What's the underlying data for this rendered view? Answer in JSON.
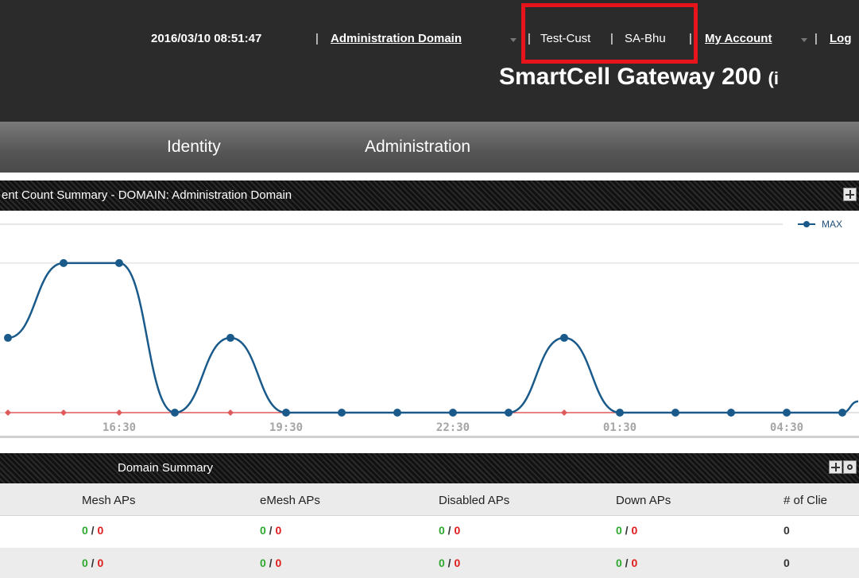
{
  "header": {
    "datetime": "2016/03/10 08:51:47",
    "sep": "|",
    "admin_domain": "Administration Domain",
    "tenant": "Test-Cust",
    "user": "SA-Bhu",
    "my_account": "My Account",
    "logout_partial": "Log",
    "product_title": "SmartCell Gateway 200",
    "product_suffix": "(i",
    "highlight_color": "#e8141b"
  },
  "nav": {
    "items": [
      {
        "label": "Identity"
      },
      {
        "label": "Administration"
      }
    ]
  },
  "chart_panel": {
    "title": "ent Count Summary - DOMAIN: Administration Domain",
    "expand_icon": "plus-square-icon"
  },
  "chart_data": {
    "type": "line",
    "x_tick_labels": [
      "16:30",
      "19:30",
      "22:30",
      "01:30",
      "04:30"
    ],
    "series": [
      {
        "name": "MAX",
        "color": "#1a5a8a",
        "values": [
          1,
          2,
          2,
          0,
          1,
          0,
          0,
          0,
          0,
          0,
          1,
          0,
          0,
          0,
          0,
          0
        ],
        "partial_end": 0.15
      },
      {
        "name": "",
        "color": "#e05a5a",
        "values": [
          0,
          0,
          0,
          0,
          0,
          0,
          0,
          0,
          0,
          0,
          0,
          0,
          0,
          0,
          0,
          0
        ]
      }
    ],
    "x_step_minutes": 60,
    "ylim": [
      0,
      2.7
    ],
    "gridlines_at": [
      2
    ],
    "legend_position": "top-right"
  },
  "summary_panel": {
    "title": "Domain Summary",
    "icons": [
      "plus-square-icon",
      "gear-icon"
    ]
  },
  "table": {
    "columns": [
      "Mesh APs",
      "eMesh APs",
      "Disabled APs",
      "Down APs",
      "# of Clie"
    ],
    "rows": [
      {
        "mesh": {
          "a": "0",
          "sep": " / ",
          "b": "0"
        },
        "emesh": {
          "a": "0",
          "sep": " / ",
          "b": "0"
        },
        "disabled": {
          "a": "0",
          "sep": " / ",
          "b": "0"
        },
        "down": {
          "a": "0",
          "sep": " / ",
          "b": "0"
        },
        "clients": "0"
      },
      {
        "mesh": {
          "a": "0",
          "sep": " / ",
          "b": "0"
        },
        "emesh": {
          "a": "0",
          "sep": " / ",
          "b": "0"
        },
        "disabled": {
          "a": "0",
          "sep": " / ",
          "b": "0"
        },
        "down": {
          "a": "0",
          "sep": " / ",
          "b": "0"
        },
        "clients": "0"
      }
    ]
  }
}
